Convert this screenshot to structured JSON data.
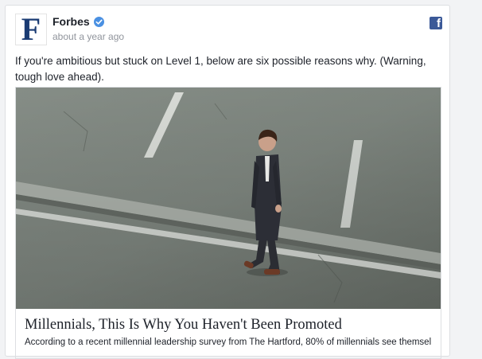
{
  "post": {
    "author": "Forbes",
    "logo_letter": "F",
    "timestamp": "about a year ago",
    "verified": true,
    "text": "If you're ambitious but stuck on Level 1, below are six possible reasons why. (Warning, tough love ahead).",
    "network_icon": "facebook-icon",
    "network_glyph": "f"
  },
  "link": {
    "title": "Millennials, This Is Why You Haven't Been Promoted",
    "description": "According to a recent millennial leadership survey from The Hartford, 80% of millennials see themsel"
  },
  "colors": {
    "brand_blue": "#1a3b73",
    "facebook_blue": "#3b5998",
    "verified_blue": "#4a90e2"
  }
}
